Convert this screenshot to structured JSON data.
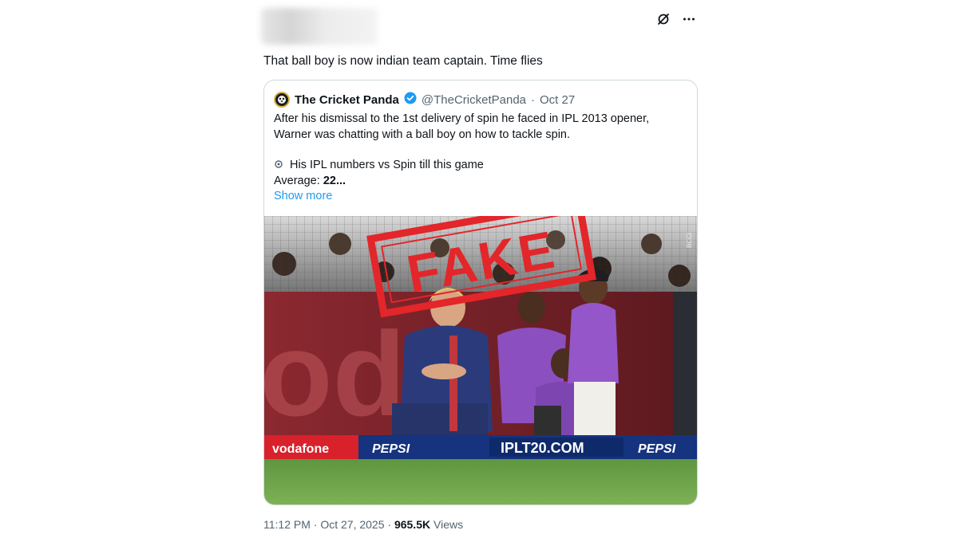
{
  "post": {
    "text": "That ball boy is now indian team captain. Time flies",
    "timestamp": "11:12 PM · Oct 27, 2025",
    "separator": "·",
    "views_count": "965.5K",
    "views_label": "Views"
  },
  "top_actions": {
    "icons": [
      "grok-icon",
      "more-options-icon"
    ]
  },
  "quote": {
    "name": "The Cricket Panda",
    "handle": "@TheCricketPanda",
    "dot": "·",
    "date": "Oct 27",
    "line1": "After his dismissal to the 1st delivery of spin he faced in IPL 2013 opener,",
    "line2": "Warner was chatting with a ball boy on how to tackle spin.",
    "line3": "His IPL numbers vs Spin till this game",
    "avg_label": "Average: ",
    "avg_value": "22...",
    "show_more": "Show more"
  },
  "image": {
    "stamp": "FAKE",
    "board_text": "odo",
    "ad_vodafone": "vodafone",
    "ad_pepsi": "PEPSI",
    "ad_ipl": "IPLT20.COM",
    "photo_credit": "BCCI",
    "colors": {
      "stamp_red": "#e3262a",
      "kit_navy": "#2b3a7a",
      "ball_boy_purple": "#8c4fc0",
      "board_red": "#7a1f25"
    }
  },
  "colors": {
    "text": "#0f1419",
    "muted": "#536471",
    "link": "#1d9bf0",
    "border": "#cfd9de",
    "verified": "#1d9bf0"
  }
}
